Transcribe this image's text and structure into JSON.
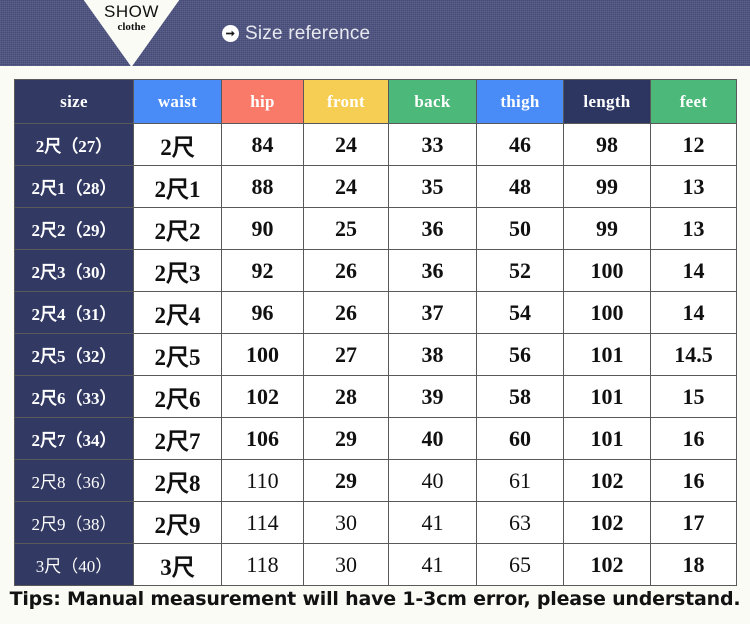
{
  "banner": {
    "logo_primary": "SHOW",
    "logo_secondary": "clothe",
    "title": "Size reference",
    "arrow_icon": "arrow-right-circle-icon",
    "background_color": "#4c5280",
    "title_color": "#e8e9f0"
  },
  "table": {
    "headers": [
      {
        "key": "size",
        "label": "size",
        "color": "#323a63"
      },
      {
        "key": "waist",
        "label": "waist",
        "color": "#4a8cf7"
      },
      {
        "key": "hip",
        "label": "hip",
        "color": "#f97a68"
      },
      {
        "key": "front",
        "label": "front",
        "color": "#f7ce54"
      },
      {
        "key": "back",
        "label": "back",
        "color": "#4cb879"
      },
      {
        "key": "thigh",
        "label": "thigh",
        "color": "#4a8cf7"
      },
      {
        "key": "length",
        "label": "length",
        "color": "#2d3561"
      },
      {
        "key": "feet",
        "label": "feet",
        "color": "#4cb879"
      }
    ],
    "rows": [
      {
        "size": "2尺（27）",
        "waist": "2尺",
        "hip": "84",
        "front": "24",
        "back": "33",
        "thigh": "46",
        "length": "98",
        "feet": "12",
        "emphasis": "bold"
      },
      {
        "size": "2尺1（28）",
        "waist": "2尺1",
        "hip": "88",
        "front": "24",
        "back": "35",
        "thigh": "48",
        "length": "99",
        "feet": "13",
        "emphasis": "bold"
      },
      {
        "size": "2尺2（29）",
        "waist": "2尺2",
        "hip": "90",
        "front": "25",
        "back": "36",
        "thigh": "50",
        "length": "99",
        "feet": "13",
        "emphasis": "bold"
      },
      {
        "size": "2尺3（30）",
        "waist": "2尺3",
        "hip": "92",
        "front": "26",
        "back": "36",
        "thigh": "52",
        "length": "100",
        "feet": "14",
        "emphasis": "bold"
      },
      {
        "size": "2尺4（31）",
        "waist": "2尺4",
        "hip": "96",
        "front": "26",
        "back": "37",
        "thigh": "54",
        "length": "100",
        "feet": "14",
        "emphasis": "bold"
      },
      {
        "size": "2尺5（32）",
        "waist": "2尺5",
        "hip": "100",
        "front": "27",
        "back": "38",
        "thigh": "56",
        "length": "101",
        "feet": "14.5",
        "emphasis": "bold"
      },
      {
        "size": "2尺6（33）",
        "waist": "2尺6",
        "hip": "102",
        "front": "28",
        "back": "39",
        "thigh": "58",
        "length": "101",
        "feet": "15",
        "emphasis": "bold"
      },
      {
        "size": "2尺7（34）",
        "waist": "2尺7",
        "hip": "106",
        "front": "29",
        "back": "40",
        "thigh": "60",
        "length": "101",
        "feet": "16",
        "emphasis": "bold"
      },
      {
        "size": "2尺8（36）",
        "waist": "2尺8",
        "hip": "110",
        "front": "29",
        "back": "40",
        "thigh": "61",
        "length": "102",
        "feet": "16",
        "emphasis": "light"
      },
      {
        "size": "2尺9（38）",
        "waist": "2尺9",
        "hip": "114",
        "front": "30",
        "back": "41",
        "thigh": "63",
        "length": "102",
        "feet": "17",
        "emphasis": "light"
      },
      {
        "size": "3尺（40）",
        "waist": "3尺",
        "hip": "118",
        "front": "30",
        "back": "41",
        "thigh": "65",
        "length": "102",
        "feet": "18",
        "emphasis": "light"
      }
    ]
  },
  "tips": {
    "text": "Tips: Manual measurement will have 1-3cm error, please understand."
  }
}
